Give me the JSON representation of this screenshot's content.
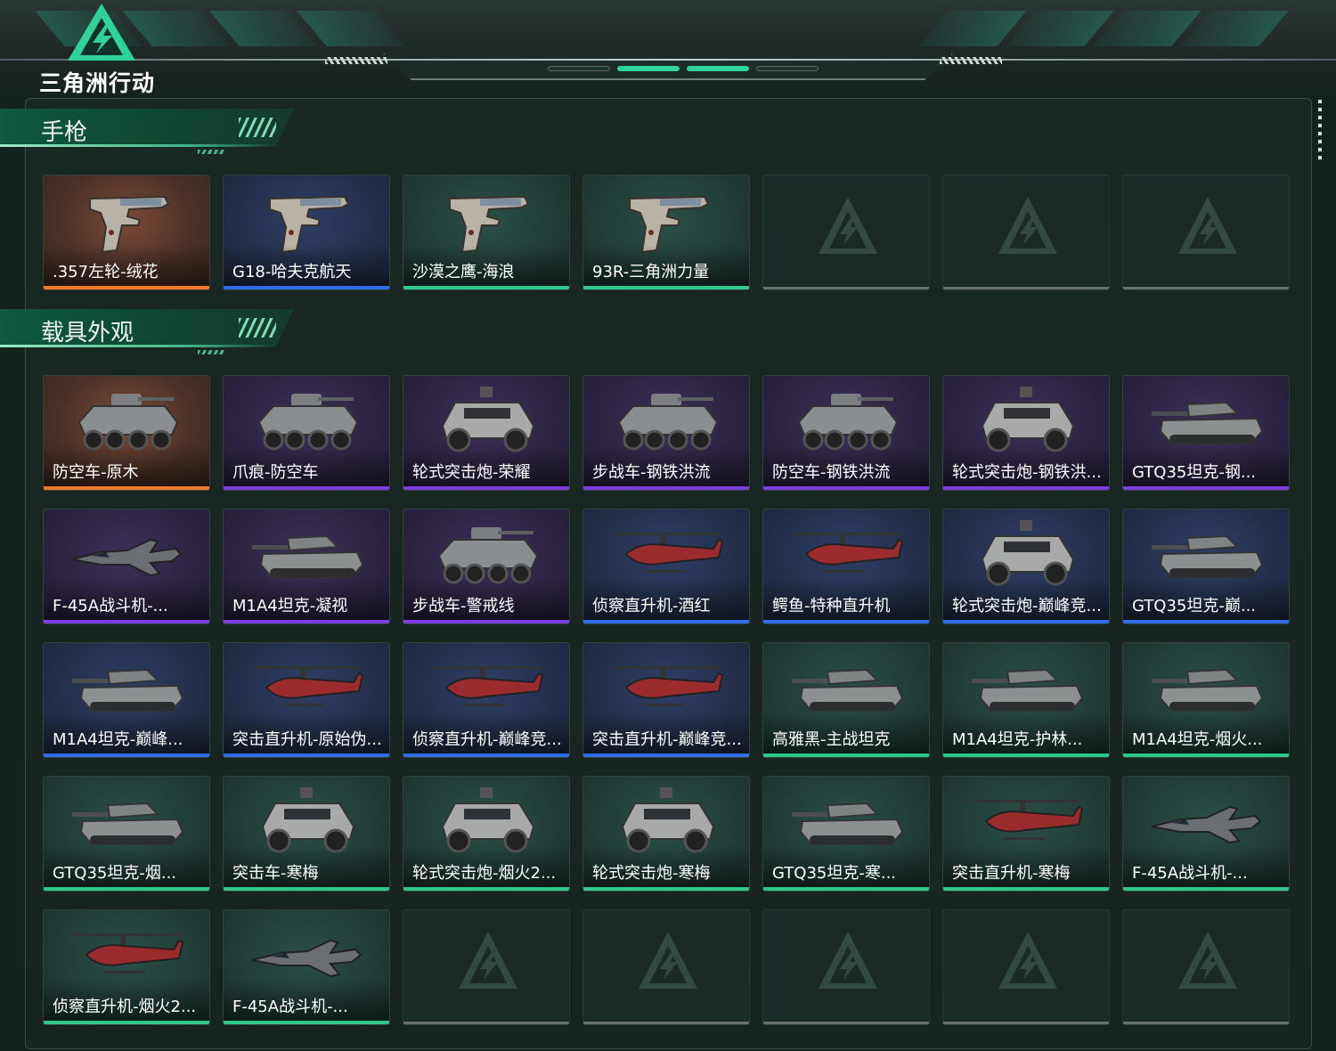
{
  "app": {
    "logo_text": "三角洲行动",
    "logo_icon": "delta-logo-icon"
  },
  "colors": {
    "orange_quality": "#f07a2a",
    "blue_quality": "#2f6ee8",
    "purple_quality": "#7b3fe0",
    "green_quality": "#2dc88a",
    "accent": "#2fd39a"
  },
  "sections": [
    {
      "title": "手枪",
      "items": [
        {
          "label": ".357左轮-绒花",
          "quality": "orange",
          "art": "pistol"
        },
        {
          "label": "G18-哈夫克航天",
          "quality": "blue",
          "art": "pistol"
        },
        {
          "label": "沙漠之鹰-海浪",
          "quality": "green",
          "art": "pistol"
        },
        {
          "label": "93R-三角洲力量",
          "quality": "green",
          "art": "pistol"
        },
        {
          "label": "",
          "quality": "empty",
          "art": "none"
        },
        {
          "label": "",
          "quality": "empty",
          "art": "none"
        },
        {
          "label": "",
          "quality": "empty",
          "art": "none"
        }
      ]
    },
    {
      "title": "载具外观",
      "items": [
        {
          "label": "防空车-原木",
          "quality": "orange",
          "art": "apc"
        },
        {
          "label": "爪痕-防空车",
          "quality": "purple",
          "art": "apc"
        },
        {
          "label": "轮式突击炮-荣耀",
          "quality": "purple",
          "art": "jeep"
        },
        {
          "label": "步战车-钢铁洪流",
          "quality": "purple",
          "art": "apc"
        },
        {
          "label": "防空车-钢铁洪流",
          "quality": "purple",
          "art": "apc"
        },
        {
          "label": "轮式突击炮-钢铁洪...",
          "quality": "purple",
          "art": "jeep"
        },
        {
          "label": "GTQ35坦克-钢...",
          "quality": "purple",
          "art": "tank"
        },
        {
          "label": "F-45A战斗机-...",
          "quality": "purple",
          "art": "jet"
        },
        {
          "label": "M1A4坦克-凝视",
          "quality": "purple",
          "art": "tank"
        },
        {
          "label": "步战车-警戒线",
          "quality": "purple",
          "art": "apc"
        },
        {
          "label": "侦察直升机-酒红",
          "quality": "blue",
          "art": "heli"
        },
        {
          "label": "鳄鱼-特种直升机",
          "quality": "blue",
          "art": "heli"
        },
        {
          "label": "轮式突击炮-巅峰竞...",
          "quality": "blue",
          "art": "jeep"
        },
        {
          "label": "GTQ35坦克-巅...",
          "quality": "blue",
          "art": "tank"
        },
        {
          "label": "M1A4坦克-巅峰...",
          "quality": "blue",
          "art": "tank"
        },
        {
          "label": "突击直升机-原始伪...",
          "quality": "blue",
          "art": "heli"
        },
        {
          "label": "侦察直升机-巅峰竞...",
          "quality": "blue",
          "art": "heli"
        },
        {
          "label": "突击直升机-巅峰竞...",
          "quality": "blue",
          "art": "heli"
        },
        {
          "label": "高雅黑-主战坦克",
          "quality": "green",
          "art": "tank"
        },
        {
          "label": "M1A4坦克-护林...",
          "quality": "green",
          "art": "tank"
        },
        {
          "label": "M1A4坦克-烟火...",
          "quality": "green",
          "art": "tank"
        },
        {
          "label": "GTQ35坦克-烟...",
          "quality": "green",
          "art": "tank"
        },
        {
          "label": "突击车-寒梅",
          "quality": "green",
          "art": "jeep"
        },
        {
          "label": "轮式突击炮-烟火2...",
          "quality": "green",
          "art": "jeep"
        },
        {
          "label": "轮式突击炮-寒梅",
          "quality": "green",
          "art": "jeep"
        },
        {
          "label": "GTQ35坦克-寒...",
          "quality": "green",
          "art": "tank"
        },
        {
          "label": "突击直升机-寒梅",
          "quality": "green",
          "art": "heli"
        },
        {
          "label": "F-45A战斗机-...",
          "quality": "green",
          "art": "jet"
        },
        {
          "label": "侦察直升机-烟火2...",
          "quality": "green",
          "art": "heli"
        },
        {
          "label": "F-45A战斗机-...",
          "quality": "green",
          "art": "jet"
        },
        {
          "label": "",
          "quality": "empty",
          "art": "none"
        },
        {
          "label": "",
          "quality": "empty",
          "art": "none"
        },
        {
          "label": "",
          "quality": "empty",
          "art": "none"
        },
        {
          "label": "",
          "quality": "empty",
          "art": "none"
        },
        {
          "label": "",
          "quality": "empty",
          "art": "none"
        }
      ]
    }
  ]
}
